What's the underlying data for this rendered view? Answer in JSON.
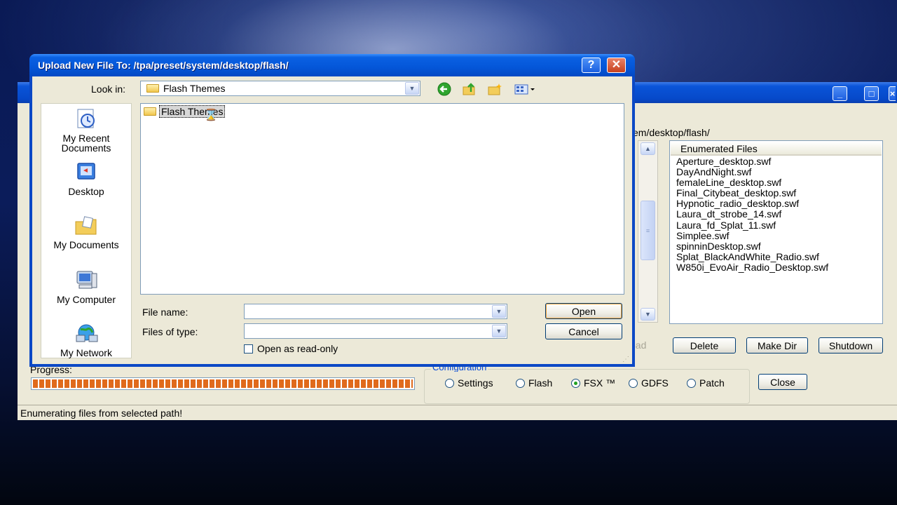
{
  "main_window": {
    "path_fragment": "em/desktop/flash/",
    "enumerated_header": "Enumerated Files",
    "files": [
      "Aperture_desktop.swf",
      "DayAndNight.swf",
      "femaleLine_desktop.swf",
      "Final_Citybeat_desktop.swf",
      "Hypnotic_radio_desktop.swf",
      "Laura_dt_strobe_14.swf",
      "Laura_fd_Splat_11.swf",
      "Simplee.swf",
      "spinninDesktop.swf",
      "Splat_BlackAndWhite_Radio.swf",
      "W850i_EvoAir_Radio_Desktop.swf"
    ],
    "buttons": {
      "load_partial": "oad",
      "delete": "Delete",
      "make_dir": "Make Dir",
      "shutdown": "Shutdown",
      "close": "Close"
    },
    "progress_label": "Progress:",
    "progress_fraction": 1.0,
    "configuration_label": "Configuration",
    "radios": [
      {
        "label": "Settings",
        "selected": false
      },
      {
        "label": "Flash",
        "selected": false
      },
      {
        "label": "FSX ™",
        "selected": true
      },
      {
        "label": "GDFS",
        "selected": false
      },
      {
        "label": "Patch",
        "selected": false
      }
    ],
    "status_text": "Enumerating files from selected path!",
    "window_controls": {
      "minimize": "_",
      "maximize": "□",
      "close": "×"
    }
  },
  "dialog": {
    "title": "Upload New File To: /tpa/preset/system/desktop/flash/",
    "help_label": "?",
    "close_label": "✕",
    "look_in_label": "Look in:",
    "look_in_value": "Flash Themes",
    "toolbar_icons": [
      "back-arrow-icon",
      "up-folder-icon",
      "new-folder-icon",
      "view-menu-icon"
    ],
    "places": [
      {
        "label_1": "My Recent",
        "label_2": "Documents",
        "icon": "recent-documents-icon"
      },
      {
        "label_1": "Desktop",
        "icon": "desktop-icon"
      },
      {
        "label_1": "My Documents",
        "icon": "my-documents-icon"
      },
      {
        "label_1": "My Computer",
        "icon": "my-computer-icon"
      },
      {
        "label_1": "My Network",
        "icon": "my-network-icon"
      }
    ],
    "file_list": [
      {
        "name": "Flash Themes",
        "type": "folder"
      }
    ],
    "file_name_label": "File name:",
    "file_name_value": "",
    "files_of_type_label": "Files of type:",
    "files_of_type_value": "",
    "open_button": "Open",
    "cancel_button": "Cancel",
    "read_only_label": "Open as read-only"
  },
  "colors": {
    "xp_title_blue": "#0a54d8",
    "progress_orange": "#e06a1c",
    "dialog_face": "#ece9d8",
    "close_red": "#c7411e"
  }
}
